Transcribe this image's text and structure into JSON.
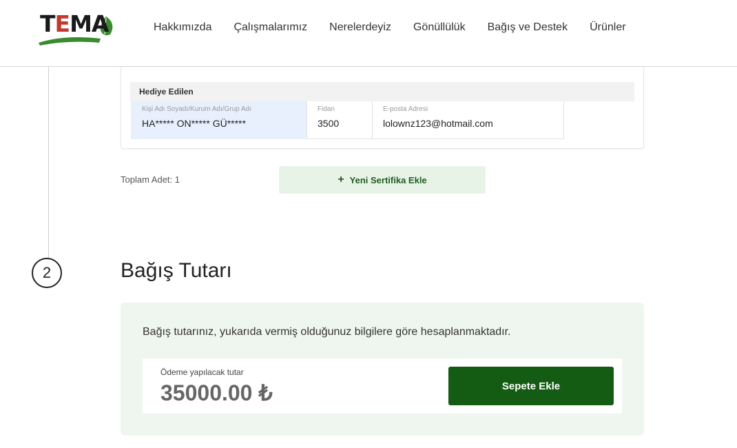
{
  "header": {
    "logo_text": "TEMA",
    "nav": [
      "Hakkımızda",
      "Çalışmalarımız",
      "Nerelerdeyiz",
      "Gönüllülük",
      "Bağış ve Destek",
      "Ürünler"
    ]
  },
  "certificate": {
    "section_label": "Hediye Edilen",
    "name_label": "Kişi Adı Soyadı/Kurum Adı/Grup Adı",
    "name_value": "HA***** ON***** GÜ*****",
    "qty_label": "Fidan",
    "qty_value": "3500",
    "email_label": "E-posta Adresi",
    "email_value": "lolownz123@hotmail.com"
  },
  "totals": {
    "count_text": "Toplam Adet: 1",
    "add_button": "Yeni Sertifika Ekle"
  },
  "step": {
    "number": "2",
    "title": "Bağış Tutarı"
  },
  "donation": {
    "description": "Bağış tutarınız, yukarıda vermiş olduğunuz bilgilere göre hesaplanmaktadır.",
    "pay_label": "Ödeme yapılacak tutar",
    "amount": "35000.00 ₺",
    "cart_button": "Sepete Ekle"
  },
  "colors": {
    "brand_green": "#145c14",
    "light_green_bg": "#eff6ef",
    "add_button_bg": "#e8f3e8",
    "autofill_bg": "#e8f0fe"
  }
}
